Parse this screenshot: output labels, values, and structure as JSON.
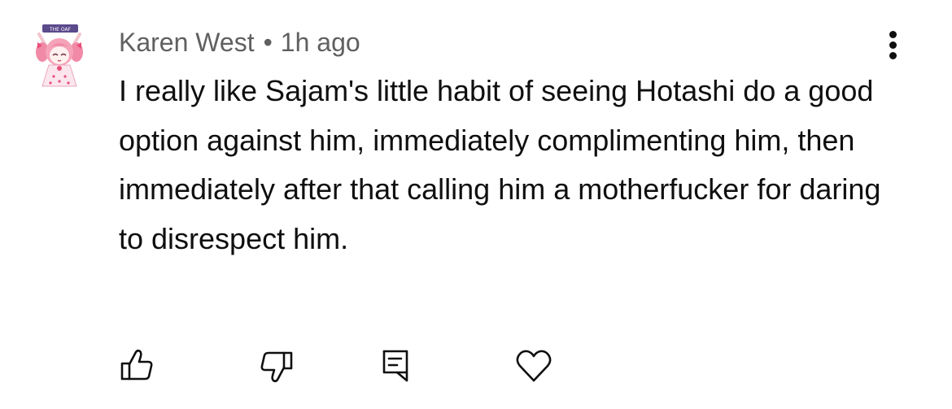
{
  "comment": {
    "author": "Karen West",
    "separator": "•",
    "timestamp": "1h ago",
    "text": "I really like Sajam's little habit of seeing Hotashi do a good option against him, immediately complimenting him, then immediately after that calling him a motherfucker for daring to disrespect him.",
    "avatar_badge_text": "THE OAF"
  },
  "actions": {
    "like_icon": "thumbs-up-icon",
    "dislike_icon": "thumbs-down-icon",
    "reply_icon": "comment-icon",
    "heart_icon": "heart-icon",
    "more_icon": "more-vertical-icon"
  },
  "colors": {
    "text": "#0f0f0f",
    "meta": "#606060",
    "background": "#ffffff"
  }
}
